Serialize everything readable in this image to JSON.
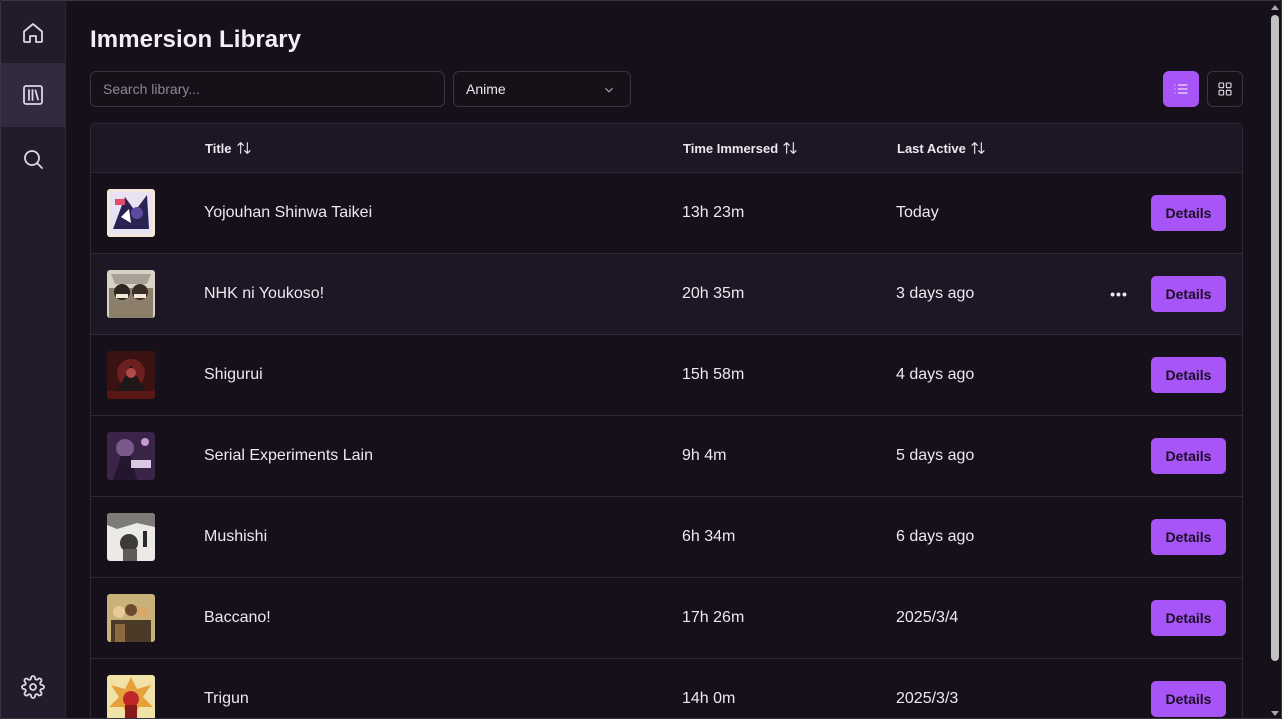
{
  "app": {
    "title": "Immersion Library"
  },
  "sidebar": {
    "items": [
      {
        "name": "home",
        "icon": "home-icon"
      },
      {
        "name": "library",
        "icon": "library-icon",
        "active": true
      },
      {
        "name": "search",
        "icon": "search-icon"
      },
      {
        "name": "settings",
        "icon": "gear-icon"
      }
    ]
  },
  "toolbar": {
    "search_placeholder": "Search library...",
    "search_value": "",
    "filter_selected": "Anime",
    "view_list_icon": "list-icon",
    "view_grid_icon": "grid-icon"
  },
  "table": {
    "headers": {
      "title": "Title",
      "time": "Time Immersed",
      "last": "Last Active"
    },
    "details_label": "Details",
    "rows": [
      {
        "title": "Yojouhan Shinwa Taikei",
        "time": "13h 23m",
        "last": "Today"
      },
      {
        "title": "NHK ni Youkoso!",
        "time": "20h 35m",
        "last": "3 days ago"
      },
      {
        "title": "Shigurui",
        "time": "15h 58m",
        "last": "4 days ago"
      },
      {
        "title": "Serial Experiments Lain",
        "time": "9h 4m",
        "last": "5 days ago"
      },
      {
        "title": "Mushishi",
        "time": "6h 34m",
        "last": "6 days ago"
      },
      {
        "title": "Baccano!",
        "time": "17h 26m",
        "last": "2025/3/4"
      },
      {
        "title": "Trigun",
        "time": "14h 0m",
        "last": "2025/3/3"
      }
    ]
  },
  "colors": {
    "accent": "#a855f7",
    "background": "#151019",
    "sidebar": "#231a2c"
  }
}
